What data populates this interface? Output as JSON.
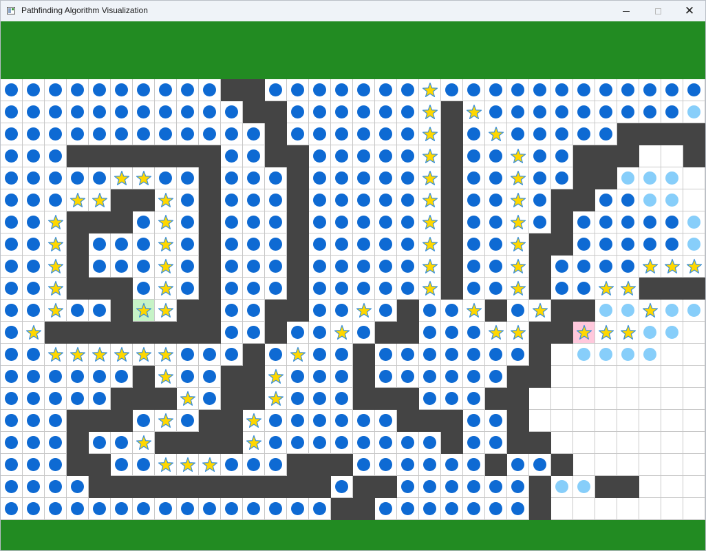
{
  "window": {
    "title": "Pathfinding Algorithm Visualization",
    "controls": [
      "minimize",
      "maximize",
      "close"
    ]
  },
  "colors": {
    "title_bar": "#eff3f8",
    "panel": "#228b22",
    "wall": "#444444",
    "empty": "#ffffff",
    "grid_line": "#c8c8c8",
    "visited": "#0e6ad3",
    "frontier": "#87cefa",
    "path_star": "#ffd700",
    "start": "#c6f3c6",
    "goal": "#ffc8dc"
  },
  "icons": {
    "visited": "filled-circle-icon",
    "frontier": "light-circle-icon",
    "path": "star-icon"
  },
  "grid": {
    "cols": 32,
    "rows": 20,
    "legend": "#=wall o=visited f=frontier *=path S=start G=goal .=empty",
    "map": [
      "oooooooooo##ooooooo*oooooooooooof",
      "ooooooooooo##oooooo*#*ooooooooof",
      "oooooooooooo#oooooo*#o*ooooo####",
      "ooo#######oo##ooooo*#oo*oo###..#",
      "ooooo**oo#ooo#ooooo*#oo*oo##fff.",
      "ooo**##*o#ooo#ooooo*#oo*o##ooff.",
      "oo*###o*o#ooo#ooooo*#oo*o#ooooof",
      "oo*#ooo*o#ooo#ooooo*#oo*##oooooff",
      "oo*#ooo*o#ooo#ooooo*#oo*#oooo***ff",
      "oo*###o*o#ooo#ooooo*#oo*#oo**###*f",
      "oo*oo#S*##oo##oo*o#oo*#o*##ff*ff",
      "o*########oo#oo*o##ooo**##G**ff.",
      "oo******ooo#o*oo#ooooooo#.ffff..",
      "oooooo#*oo##*ooo#oooooo##......",
      "ooooo###*o##*ooo###ooo##......",
      "ooo###o*o##*oooooo###oo#.......",
      "ooo#oo*####*oooooooo#oo##......",
      "ooo##oo***ooo###oooooo#oo#......",
      "oooo###########o##oooooo#ff##.....",
      "ooooooooooooooo##ooooooo#......."
    ]
  }
}
